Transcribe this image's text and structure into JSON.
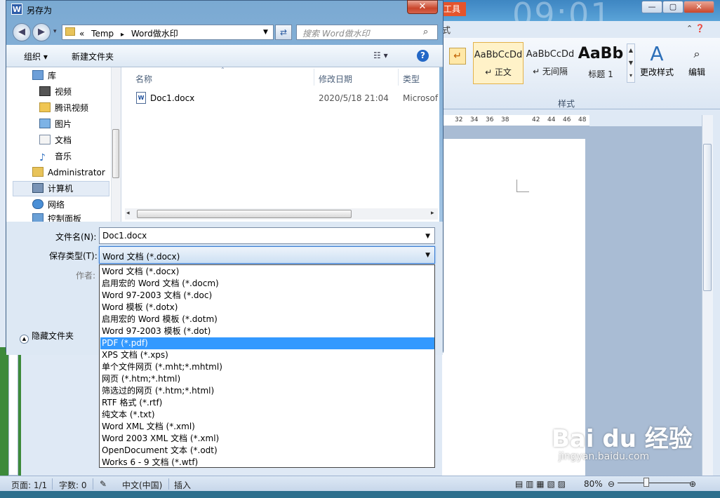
{
  "background_word": {
    "tools_tab": "工具",
    "clock": "09:01",
    "ribbon_tab_fragment": "式",
    "styles": [
      {
        "preview": "AaBbCcDd",
        "caption": "↵ 正文"
      },
      {
        "preview": "AaBbCcDd",
        "caption": "↵ 无间隔"
      },
      {
        "preview": "AaBb",
        "caption": "标题 1"
      }
    ],
    "change_styles": "更改样式",
    "edit": "编辑",
    "styles_group_label": "样式",
    "ruler_ticks": [
      "32",
      "34",
      "36",
      "38",
      "42",
      "44",
      "46",
      "48"
    ],
    "watermark": {
      "logo": "Bai du 经验",
      "url": "jingyan.baidu.com"
    }
  },
  "status_bar": {
    "page": "页面: 1/1",
    "words": "字数: 0",
    "language": "中文(中国)",
    "insert_mode": "插入",
    "zoom": "80%"
  },
  "dialog": {
    "title": "另存为",
    "close": "✕",
    "address": {
      "prefix": "«",
      "path_1": "Temp",
      "sep": "▸",
      "path_2": "Word做水印"
    },
    "search_placeholder": "搜索 Word做水印",
    "toolbar": {
      "organize": "组织 ▾",
      "new_folder": "新建文件夹"
    },
    "nav_items": [
      {
        "label": "库",
        "icon": "library-icon"
      },
      {
        "label": "视频",
        "icon": "video-icon"
      },
      {
        "label": "腾讯视频",
        "icon": "folder-icon"
      },
      {
        "label": "图片",
        "icon": "pictures-icon"
      },
      {
        "label": "文档",
        "icon": "documents-icon"
      },
      {
        "label": "音乐",
        "icon": "music-icon"
      },
      {
        "label": "Administrator",
        "icon": "user-folder-icon"
      },
      {
        "label": "计算机",
        "icon": "computer-icon"
      },
      {
        "label": "网络",
        "icon": "network-icon"
      },
      {
        "label": "控制面板",
        "icon": "control-panel-icon"
      }
    ],
    "columns": {
      "name": "名称",
      "modified": "修改日期",
      "type": "类型"
    },
    "files": [
      {
        "name": "Doc1.docx",
        "modified": "2020/5/18 21:04",
        "type": "Microsof"
      }
    ],
    "form": {
      "filename_label": "文件名(N):",
      "filename_value": "Doc1.docx",
      "filetype_label": "保存类型(T):",
      "filetype_value": "Word 文档 (*.docx)",
      "author_label": "作者:",
      "hide_folders": "隐藏文件夹"
    },
    "filetype_options": [
      "Word 文档 (*.docx)",
      "启用宏的 Word 文档 (*.docm)",
      "Word 97-2003 文档 (*.doc)",
      "Word 模板 (*.dotx)",
      "启用宏的 Word 模板 (*.dotm)",
      "Word 97-2003 模板 (*.dot)",
      "PDF (*.pdf)",
      "XPS 文档 (*.xps)",
      "单个文件网页 (*.mht;*.mhtml)",
      "网页 (*.htm;*.html)",
      "筛选过的网页 (*.htm;*.html)",
      "RTF 格式 (*.rtf)",
      "纯文本 (*.txt)",
      "Word XML 文档 (*.xml)",
      "Word 2003 XML 文档 (*.xml)",
      "OpenDocument 文本 (*.odt)",
      "Works 6 - 9 文档 (*.wtf)"
    ],
    "highlighted_option_index": 6
  }
}
